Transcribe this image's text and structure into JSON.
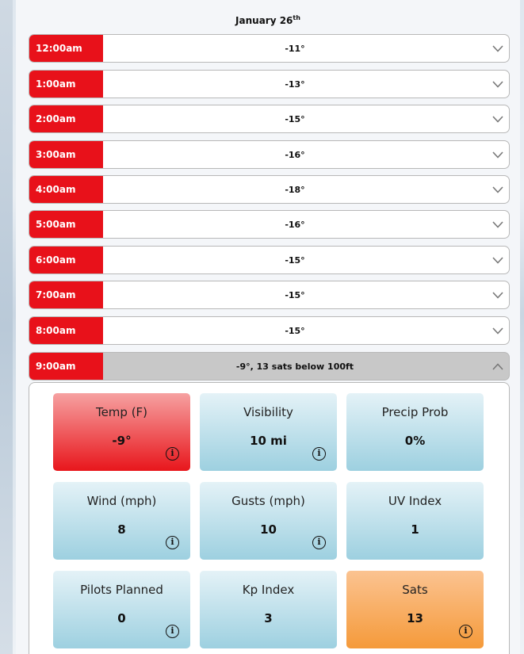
{
  "date": {
    "month_day": "January 26",
    "suffix": "th"
  },
  "rows": [
    {
      "time": "12:00am",
      "value": "-11°"
    },
    {
      "time": "1:00am",
      "value": "-13°"
    },
    {
      "time": "2:00am",
      "value": "-15°"
    },
    {
      "time": "3:00am",
      "value": "-16°"
    },
    {
      "time": "4:00am",
      "value": "-18°"
    },
    {
      "time": "5:00am",
      "value": "-16°"
    },
    {
      "time": "6:00am",
      "value": "-15°"
    },
    {
      "time": "7:00am",
      "value": "-15°"
    },
    {
      "time": "8:00am",
      "value": "-15°"
    },
    {
      "time": "9:00am",
      "value": "-9°, 13 sats below 100ft",
      "expanded": true
    }
  ],
  "icons": {
    "collapsed": "chevron-down-icon",
    "expanded": "chevron-up-icon",
    "info": "info-icon"
  },
  "colors": {
    "hour_label": "#e8111a",
    "tile_default": "#9dd0e0",
    "tile_temp": "#e8161c",
    "tile_sats": "#f59a3a",
    "expanded_row": "#c8c8c8"
  },
  "tiles": [
    {
      "title": "Temp (F)",
      "value": "-9°",
      "info": true,
      "style": "red"
    },
    {
      "title": "Visibility",
      "value": "10 mi",
      "info": true
    },
    {
      "title": "Precip Prob",
      "value": "0%",
      "info": false
    },
    {
      "title": "Wind (mph)",
      "value": "8",
      "info": true
    },
    {
      "title": "Gusts (mph)",
      "value": "10",
      "info": true
    },
    {
      "title": "UV Index",
      "value": "1",
      "info": false
    },
    {
      "title": "Pilots Planned",
      "value": "0",
      "info": true
    },
    {
      "title": "Kp Index",
      "value": "3",
      "info": false
    },
    {
      "title": "Sats",
      "value": "13",
      "info": true,
      "style": "orange"
    }
  ],
  "info_glyph": "i"
}
